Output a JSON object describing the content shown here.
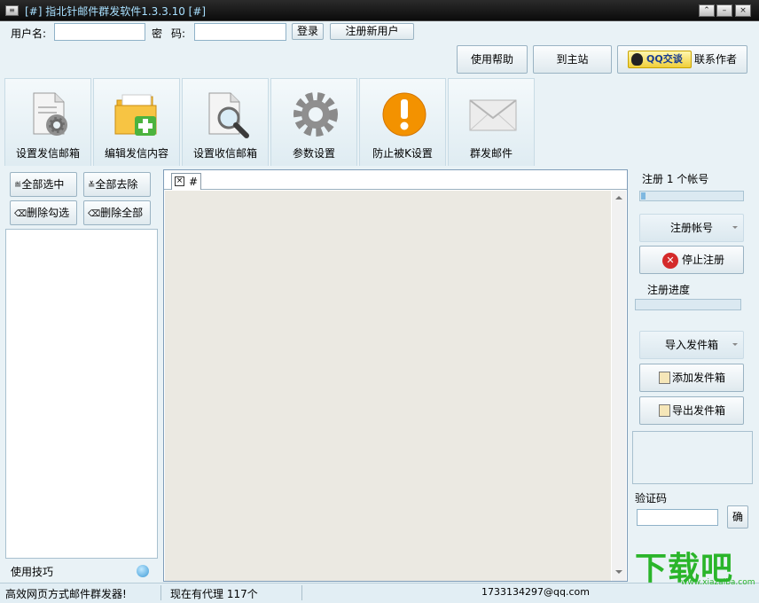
{
  "window": {
    "title": "[#] 指北针邮件群发软件1.3.3.10 [#]",
    "menu_glyph": "≡",
    "controls": {
      "restore": "⌃",
      "minimize": "–",
      "close": "×"
    }
  },
  "login": {
    "username_label": "用户名:",
    "username_value": "",
    "password_label_a": "密",
    "password_label_b": "码:",
    "password_value": "",
    "login_button": "登录",
    "register_button": "注册新用户"
  },
  "topnav": {
    "help": "使用帮助",
    "homepage": "到主站",
    "qq_badge": "QQ交谈",
    "contact": "联系作者"
  },
  "toolbar": [
    {
      "label": "设置发信邮箱",
      "icon": "document-gear-icon"
    },
    {
      "label": "编辑发信内容",
      "icon": "folder-add-icon"
    },
    {
      "label": "设置收信邮箱",
      "icon": "document-search-icon"
    },
    {
      "label": "参数设置",
      "icon": "gear-icon"
    },
    {
      "label": "防止被K设置",
      "icon": "warning-icon"
    },
    {
      "label": "群发邮件",
      "icon": "envelope-icon"
    }
  ],
  "left_panel": {
    "select_all": "全部选中",
    "deselect_all": "全部去除",
    "delete_checked": "删除勾选",
    "delete_all": "删除全部",
    "tips": "使用技巧"
  },
  "editor": {
    "tab_label": "#",
    "tab_close": "×"
  },
  "right_panel": {
    "register_count": "注册 1 个帐号",
    "register_progress": 0.04,
    "register_account": "注册帐号",
    "stop_register": "停止注册",
    "register_progress_label": "注册进度",
    "register_progress_value": 0,
    "import_sender": "导入发件箱",
    "add_sender": "添加发件箱",
    "export_sender": "导出发件箱",
    "captcha_label": "验证码",
    "captcha_value": "",
    "confirm": "确"
  },
  "status": {
    "slogan": "高效网页方式邮件群发器!",
    "proxy": "现在有代理 117个",
    "email": "1733134297@qq.com"
  },
  "watermark": {
    "big": "下载吧",
    "small": "www.xiazaiba.com"
  },
  "colors": {
    "window_bg": "#e9f2f6",
    "title_text": "#a8e0ff",
    "watermark_green": "#2ab52a",
    "stop_red": "#d42a2a"
  }
}
